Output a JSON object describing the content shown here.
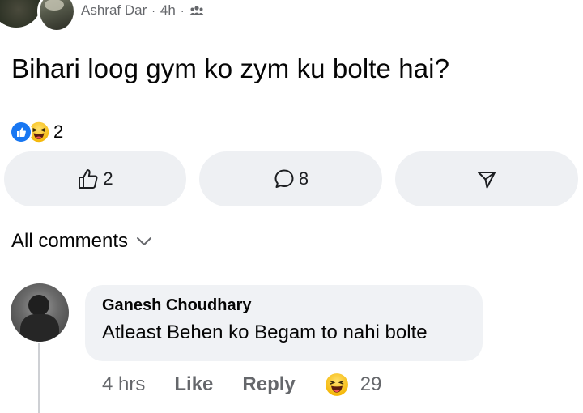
{
  "post": {
    "author": "Ashraf Dar",
    "time": "4h",
    "separator": "·",
    "text": "Bihari loog gym ko zym ku bolte hai?",
    "reaction_count": "2"
  },
  "actions": {
    "like_count": "2",
    "comment_count": "8"
  },
  "comments_filter": {
    "label": "All comments"
  },
  "comment": {
    "author": "Ganesh Choudhary",
    "text": "Atleast Behen ko Begam to nahi bolte",
    "time": "4 hrs",
    "like_label": "Like",
    "reply_label": "Reply",
    "reaction_count": "29"
  },
  "colors": {
    "accent": "#1877f2",
    "button_bg": "#eef0f3",
    "bubble_bg": "#f0f2f5",
    "secondary_text": "#65676b"
  },
  "icons": [
    "audience-group-icon",
    "like-reaction-icon",
    "haha-reaction-icon",
    "thumbs-up-icon",
    "comment-icon",
    "share-icon",
    "chevron-down-icon"
  ]
}
